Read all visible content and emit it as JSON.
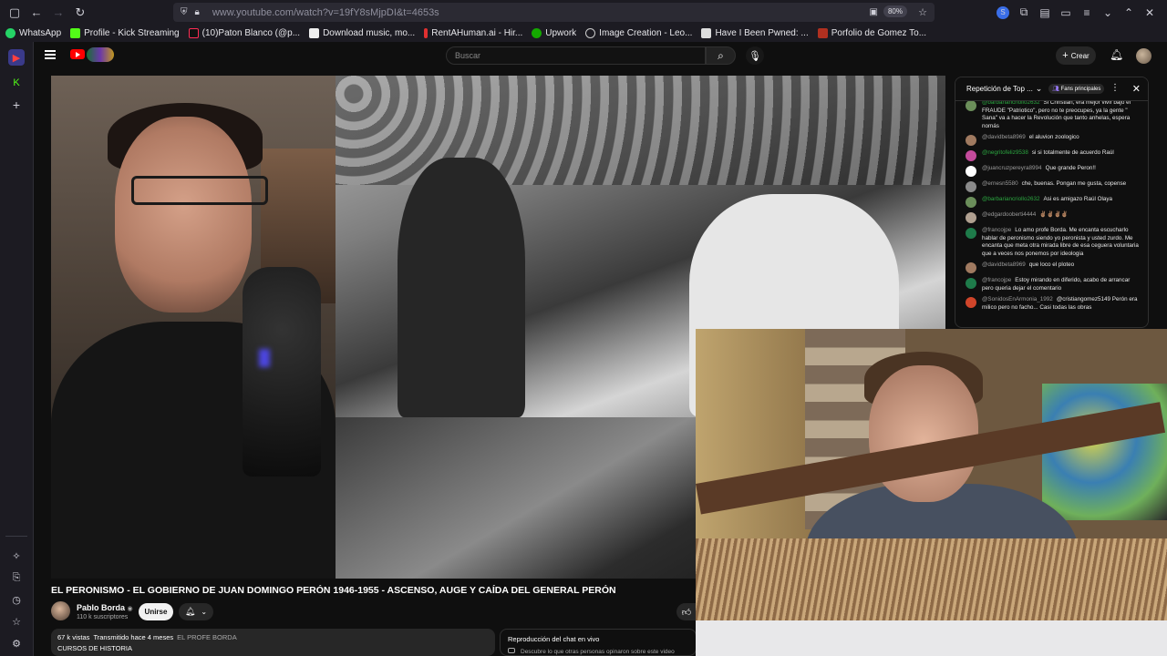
{
  "browser": {
    "url": "www.youtube.com/watch?v=19fY8sMjpDI&t=4653s",
    "zoom": "80%"
  },
  "bookmarks": [
    {
      "label": "WhatsApp",
      "color": "#25d366"
    },
    {
      "label": "Profile - Kick Streaming",
      "color": "#53fc18"
    },
    {
      "label": "(10)Paton Blanco (@p...",
      "color": "#111111"
    },
    {
      "label": "Download music, mo...",
      "color": "#eeeeee"
    },
    {
      "label": "RentAHuman.ai - Hir...",
      "color": "#e03030"
    },
    {
      "label": "Upwork",
      "color": "#14a800"
    },
    {
      "label": "Image Creation - Leo...",
      "color": "#8a5cf6"
    },
    {
      "label": "Have I Been Pwned: ...",
      "color": "#dddddd"
    },
    {
      "label": "Porfolio de Gomez To...",
      "color": "#b03020"
    }
  ],
  "youtube": {
    "search_placeholder": "Buscar",
    "create_label": "Crear"
  },
  "video": {
    "title": "EL PERONISMO - EL GOBIERNO DE JUAN DOMINGO PERÓN 1946-1955 - ASCENSO, AUGE Y CAÍDA DEL GENERAL PERÓN",
    "channel": "Pablo Borda",
    "subscribers": "110 k suscriptores",
    "join_label": "Unirse",
    "views": "67 k vistas",
    "streamed": "Transmitido hace 4 meses",
    "channel_tag": "EL PROFE BORDA",
    "category": "CURSOS DE HISTORIA"
  },
  "chat_replay": {
    "title": "Reproducción del chat en vivo",
    "subtitle": "Descubre lo que otras personas opinaron sobre este video"
  },
  "live_chat": {
    "title": "Repetición de Top ...",
    "badge": "Fans principales",
    "messages": [
      {
        "author": "@barbariancriollo2632",
        "member": true,
        "text": "Si Christian, era mejor vivir bajo el FRAUDE \"Patriotico\", pero no te preocupes, ya la gente \" Sana\" va a hacer la Revolución que tanto anhelas, espera nomás",
        "avatar": "#6b8e5a"
      },
      {
        "author": "@davidbeta8969",
        "member": false,
        "text": "el aluvion zoologico",
        "avatar": "#a07a60"
      },
      {
        "author": "@negritofeliz9538",
        "member": true,
        "text": "si si totalmente de acuerdo Raúl",
        "avatar": "#c44b9c"
      },
      {
        "author": "@juancruzpereyra8994",
        "member": false,
        "text": "Que grande Peron!!",
        "avatar": "#ffffff"
      },
      {
        "author": "@ernesn5580",
        "member": false,
        "text": "che, buenas. Pongan me gusta, copense",
        "avatar": "#8a8a8a"
      },
      {
        "author": "@barbariancriollo2632",
        "member": true,
        "text": "Asi es amigazo Raúl Olaya",
        "avatar": "#6b8e5a"
      },
      {
        "author": "@edgardooberti4444",
        "member": false,
        "text": "✌🏽✌🏽✌🏽✌🏽",
        "avatar": "#b0a090"
      },
      {
        "author": "@francojpe",
        "member": false,
        "text": "Lo amo profe Borda. Me encanta escucharlo hablar de peronismo siendo yo peronista y usted zurdo. Me encanta que meta otra mirada libre de esa ceguera voluntaria que a veces nos ponemos por ideologia",
        "avatar": "#1e7b4a"
      },
      {
        "author": "@davidbeta8969",
        "member": false,
        "text": "que loco el ploteo",
        "avatar": "#a07a60"
      },
      {
        "author": "@francojpe",
        "member": false,
        "text": "Estoy mirando en diferido, acabo de arrancar pero queria dejar el comentario",
        "avatar": "#1e7b4a"
      },
      {
        "author": "@SonidosEnArmonia_1992",
        "member": false,
        "text": "@cristiangomez5149 Perón era milico pero no facho... Casi todas las obras",
        "avatar": "#d0452a"
      }
    ]
  }
}
